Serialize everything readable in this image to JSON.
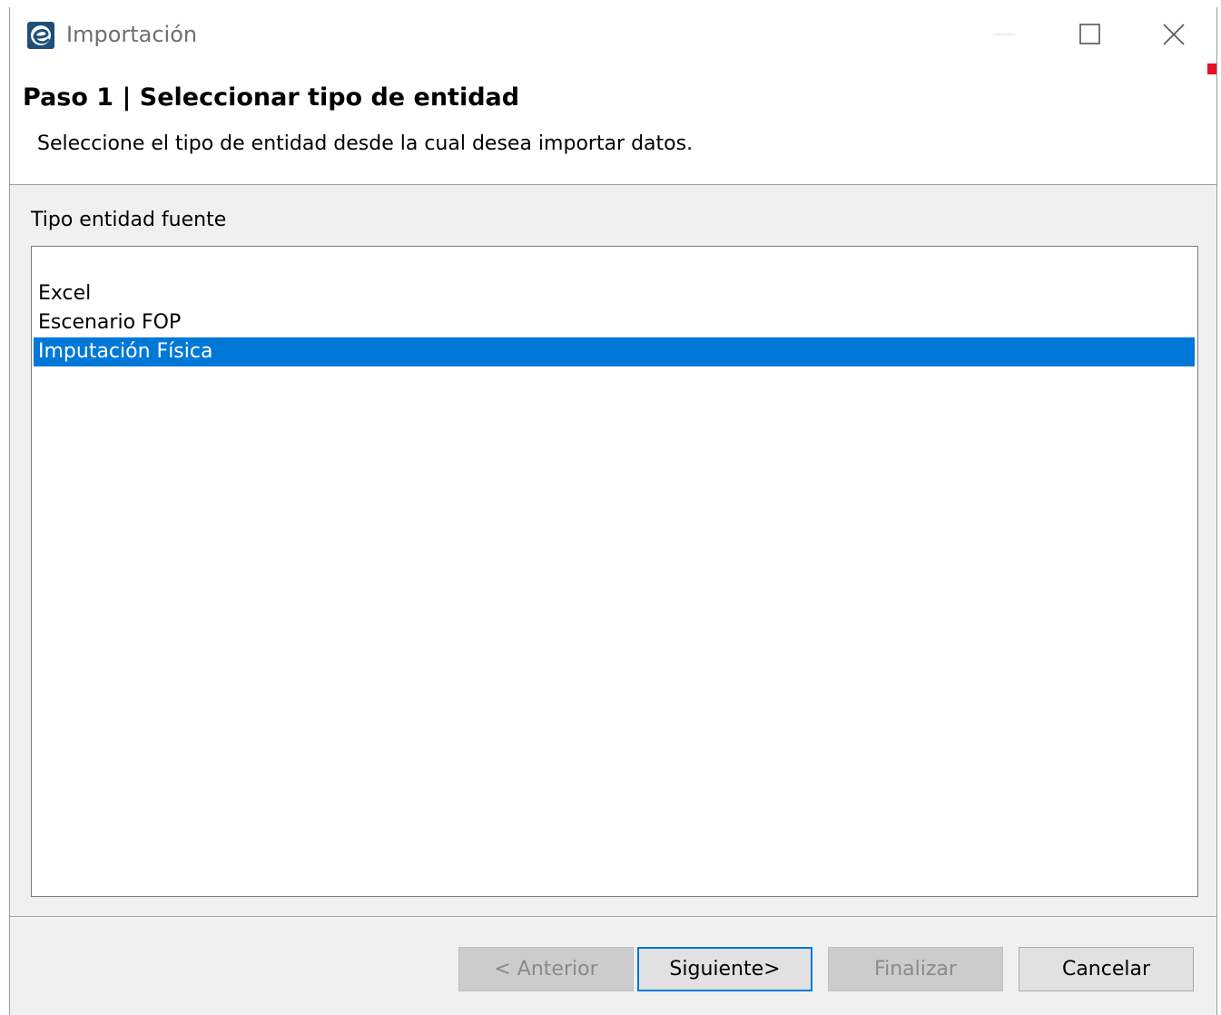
{
  "window": {
    "title": "Importación",
    "app_icon": "e-logo-icon",
    "controls": [
      "minimize-icon",
      "maximize-icon",
      "close-icon"
    ]
  },
  "header": {
    "title": "Paso 1 | Seleccionar tipo de entidad",
    "description": "Seleccione el tipo de entidad desde la cual desea importar datos."
  },
  "source_list": {
    "label": "Tipo entidad fuente",
    "items": [
      {
        "label": "Excel",
        "selected": false
      },
      {
        "label": "Escenario FOP",
        "selected": false
      },
      {
        "label": "Imputación Física",
        "selected": true
      }
    ]
  },
  "buttons": {
    "previous": "< Anterior",
    "next": "Siguiente>",
    "finish": "Finalizar",
    "cancel": "Cancelar"
  },
  "colors": {
    "selection": "#0078d7",
    "accent_mark": "#e81123"
  }
}
